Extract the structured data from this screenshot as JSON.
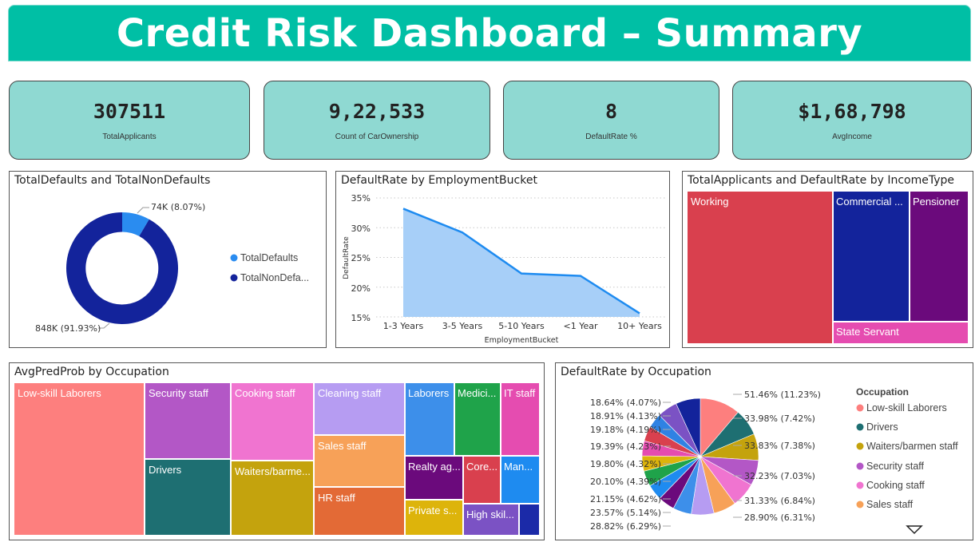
{
  "header": {
    "title": "Credit Risk Dashboard – Summary"
  },
  "kpis": [
    {
      "value": "307511",
      "label": "TotalApplicants"
    },
    {
      "value": "9,22,533",
      "label": "Count of CarOwnership"
    },
    {
      "value": "8",
      "label": "DefaultRate %"
    },
    {
      "value": "$1,68,798",
      "label": "AvgIncome"
    }
  ],
  "donut": {
    "title": "TotalDefaults and TotalNonDefaults",
    "label_defaults": "74K (8.07%)",
    "label_nondefaults": "848K (91.93%)",
    "legend": [
      "TotalDefaults",
      "TotalNonDefa..."
    ],
    "colors": [
      "#2A8CF0",
      "#13239B"
    ]
  },
  "employment": {
    "title": "DefaultRate by EmploymentBucket",
    "xlabel": "EmploymentBucket",
    "ylabel": "DefaultRate",
    "yticks": [
      "35%",
      "30%",
      "25%",
      "20%",
      "15%"
    ]
  },
  "income": {
    "title": "TotalApplicants and DefaultRate by IncomeType",
    "cells": [
      "Working",
      "Commercial ...",
      "Pensioner",
      "State Servant"
    ]
  },
  "occupation_tree": {
    "title": "AvgPredProb by Occupation",
    "cells": [
      "Low-skill Laborers",
      "Security staff",
      "Cooking staff",
      "Cleaning staff",
      "Laborers",
      "Medici...",
      "IT staff",
      "Drivers",
      "Waiters/barme...",
      "Sales staff",
      "Realty ag...",
      "Core...",
      "Man...",
      "HR staff",
      "Private s...",
      "High skil..."
    ]
  },
  "occupation_pie": {
    "title": "DefaultRate by Occupation",
    "legend_title": "Occupation",
    "legend": [
      "Low-skill Laborers",
      "Drivers",
      "Waiters/barmen staff",
      "Security staff",
      "Cooking staff",
      "Sales staff"
    ],
    "legend_colors": [
      "#FD7F7E",
      "#1E6F72",
      "#C4A30D",
      "#B357C6",
      "#F074D0",
      "#F7A158"
    ],
    "labels_right": [
      "51.46% (11.23%)",
      "33.98% (7.42%)",
      "33.83% (7.38%)",
      "32.23% (7.03%)",
      "31.33% (6.84%)",
      "28.90% (6.31%)"
    ],
    "labels_left": [
      "18.64% (4.07%)",
      "18.91% (4.13%)",
      "19.18% (4.19%)",
      "19.39% (4.23%)",
      "19.80% (4.32%)",
      "20.10% (4.39%)",
      "21.15% (4.62%)",
      "23.57% (5.14%)",
      "28.82% (6.29%)"
    ]
  },
  "chart_data": [
    {
      "type": "pie",
      "title": "TotalDefaults and TotalNonDefaults",
      "categories": [
        "TotalDefaults",
        "TotalNonDefaults"
      ],
      "values": [
        74000,
        848000
      ],
      "percent": [
        8.07,
        91.93
      ]
    },
    {
      "type": "area",
      "title": "DefaultRate by EmploymentBucket",
      "xlabel": "EmploymentBucket",
      "ylabel": "DefaultRate",
      "categories": [
        "1-3 Years",
        "3-5 Years",
        "5-10 Years",
        "<1 Year",
        "10+ Years"
      ],
      "values": [
        33.2,
        29.2,
        22.3,
        21.9,
        15.6
      ],
      "ylim": [
        15,
        35
      ],
      "grid": true
    },
    {
      "type": "pie",
      "title": "DefaultRate by Occupation",
      "values": [
        51.46,
        33.98,
        33.83,
        32.23,
        31.33,
        28.9,
        28.82,
        23.57,
        21.15,
        20.1,
        19.8,
        19.39,
        19.18,
        18.91,
        18.64
      ],
      "percent": [
        11.23,
        7.42,
        7.38,
        7.03,
        6.84,
        6.31,
        6.29,
        5.14,
        4.62,
        4.39,
        4.32,
        4.23,
        4.19,
        4.13,
        4.07
      ]
    }
  ]
}
